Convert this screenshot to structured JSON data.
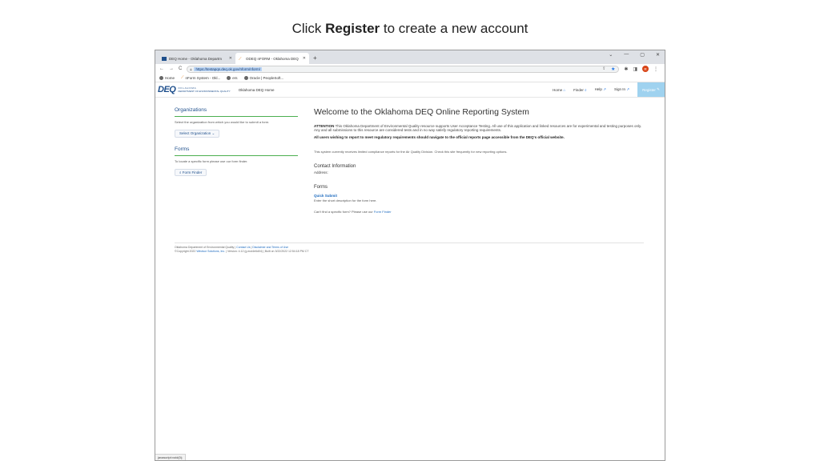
{
  "instruction": {
    "prefix": "Click",
    "emphasis": "Register",
    "suffix": "to create a new account"
  },
  "browser": {
    "tabs": [
      {
        "label": "DEQ Home - Oklahoma Departm"
      },
      {
        "label": "ODEQ nFORM - Oklahoma DEQ"
      }
    ],
    "new_tab": "+",
    "url": "https://testapqs.deq.ok.gov/nform/nform/",
    "bookmarks": [
      {
        "label": "Home",
        "icon": "globe-icon"
      },
      {
        "label": "nForm System - Okl...",
        "icon": "wing-icon"
      },
      {
        "label": "ers",
        "icon": "globe-icon"
      },
      {
        "label": "Oracle | PeopleSoft...",
        "icon": "globe-icon"
      }
    ],
    "profile_initial": "R",
    "status_text": "javascript:void(0);"
  },
  "site": {
    "logo_text": "DEQ",
    "logo_sub_1": "O K L A H O M A",
    "logo_sub_2": "DEPARTMENT OF ENVIRONMENTAL QUALITY",
    "site_name": "Oklahoma DEQ Home",
    "nav": {
      "home": "Home",
      "finder": "Finder",
      "help": "Help",
      "signin": "Sign In",
      "register": "Register"
    }
  },
  "sidebar": {
    "org_heading": "Organizations",
    "org_text": "Select the organization from which you would like to submit a form.",
    "org_button": "Select Organization",
    "forms_heading": "Forms",
    "forms_text": "To locate a specific form please use our form finder.",
    "forms_button": "Form Finder"
  },
  "main": {
    "title": "Welcome to the Oklahoma DEQ Online Reporting System",
    "attention_label": "ATTENTION",
    "attention_text": "This Oklahoma Department of Environmental Quality resource supports User Acceptance Testing. All use of this application and linked resources are for experimental and testing purposes only. Any and all submissions to this resource are considered tests and in no way satisfy regulatory reporting requirements.",
    "warning": "All users wishing to report to meet regulatory requirements should navigate to the official reports page accessible from the DEQ's official website.",
    "note": "This system currently receives limited compliance reports for the Air Quality Division. Check this site frequently for new reporting options.",
    "contact_heading": "Contact Information",
    "address_label": "Address:",
    "forms_heading": "Forms",
    "quick_submit": "Quick Submit",
    "quick_submit_desc": "Enter the short description for the form here.",
    "cant_find": "Can't find a specific form? Please use our",
    "form_finder_link": "Form Finder"
  },
  "footer": {
    "org": "Oklahoma Department of Environmental Quality",
    "contact": "Contact Us",
    "disclaimer": "Disclaimer and Terms of Use",
    "copyright": "©Copyright 2022",
    "vendor": "Windsor Solutions, Inc.",
    "version": "Version: 4.12 (g.ecd4e6d04) | Built on 3/22/2022 12:54:18 PM CT"
  }
}
